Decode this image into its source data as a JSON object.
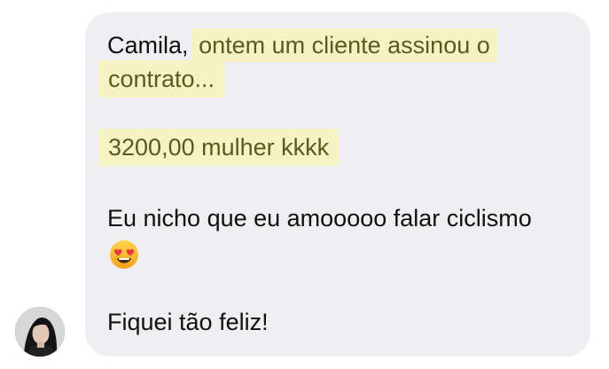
{
  "chat": {
    "message": {
      "name": "Camila",
      "comma": ",",
      "highlight1_a": "ontem um cliente assinou o",
      "highlight1_b": "contrato...",
      "highlight2": "3200,00 mulher kkkk",
      "line3": "Eu nicho que eu amooooo falar ciclismo",
      "emoji": "smiling-face-with-heart-eyes",
      "line4": "Fiquei tão feliz!"
    },
    "avatar": {
      "icon": "profile-photo"
    },
    "colors": {
      "bubble": "#efeff1",
      "highlight": "#f5f2c4",
      "highlight_text": "#5a5b1f",
      "text": "#111111"
    }
  }
}
